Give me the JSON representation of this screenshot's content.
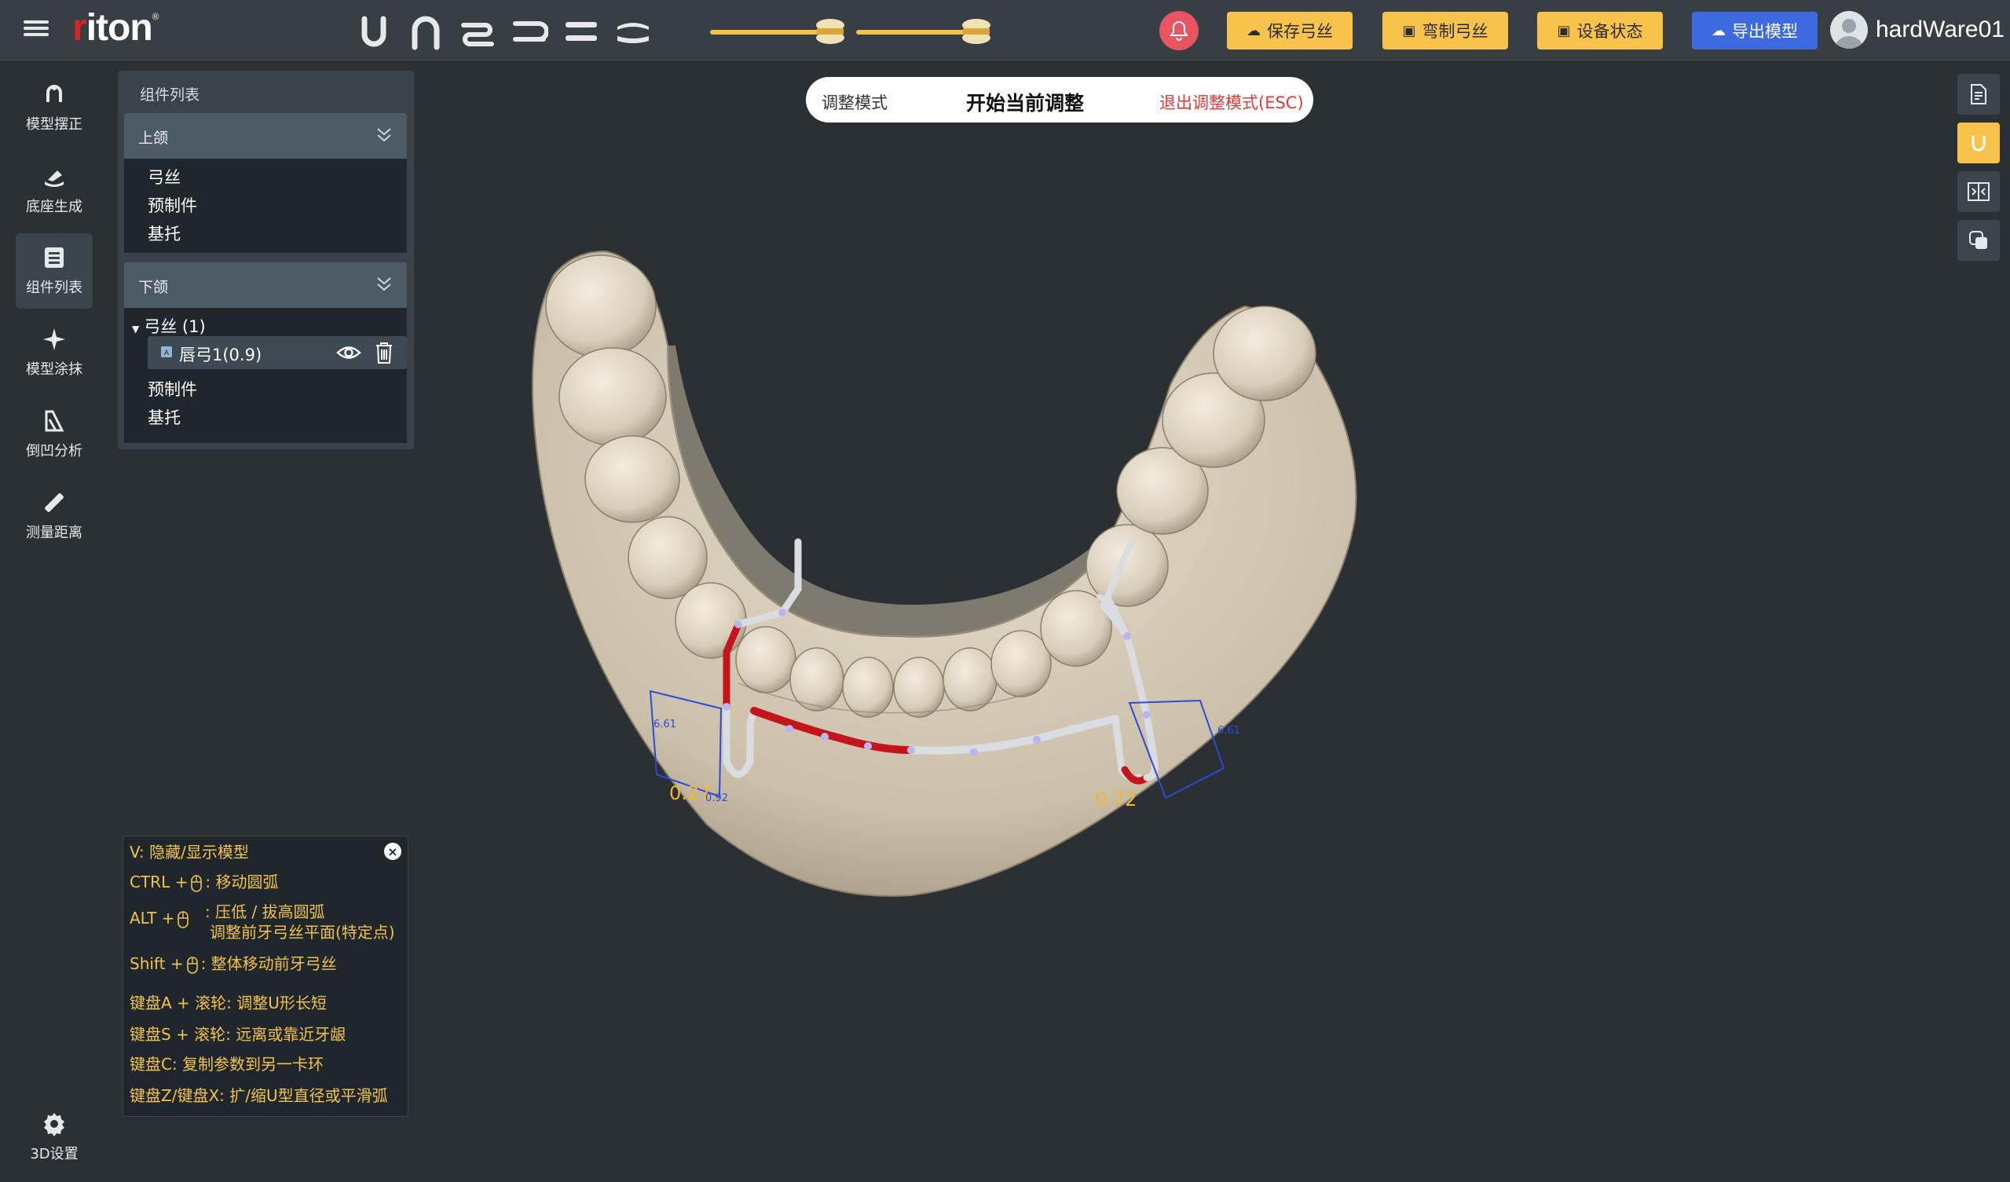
{
  "app": {
    "logo_text": "riton",
    "logo_mark": "®"
  },
  "topbar": {
    "buttons": {
      "save": "保存弓丝",
      "bend": "弯制弓丝",
      "device": "设备状态",
      "export": "导出模型"
    },
    "username": "hardWare01",
    "colors": {
      "accent_yellow": "#f8c34b",
      "accent_blue": "#3d6ae0",
      "bell": "#e8545f"
    }
  },
  "sidebar": {
    "items": [
      {
        "label": "模型摆正",
        "icon": "model-align-icon"
      },
      {
        "label": "底座生成",
        "icon": "base-generate-icon"
      },
      {
        "label": "组件列表",
        "icon": "component-list-icon"
      },
      {
        "label": "模型涂抹",
        "icon": "model-paint-icon"
      },
      {
        "label": "倒凹分析",
        "icon": "undercut-analysis-icon"
      },
      {
        "label": "测量距离",
        "icon": "measure-distance-icon"
      }
    ],
    "settings_label": "3D设置"
  },
  "component_panel": {
    "title": "组件列表",
    "upper": {
      "header": "上颌",
      "items": [
        "弓丝",
        "预制件",
        "基托"
      ]
    },
    "lower": {
      "header": "下颌",
      "wire_group": "弓丝 (1)",
      "wire_item": "唇弓1(0.9)",
      "items": [
        "预制件",
        "基托"
      ]
    }
  },
  "adjust_bar": {
    "mode_label": "调整模式",
    "start_label": "开始当前调整",
    "exit_label": "退出调整模式(ESC)"
  },
  "viewport": {
    "left_value": "0.27",
    "right_value": "0.72",
    "left_dim": "6.61",
    "right_dim": "6.61",
    "left_small": "0.92"
  },
  "help": {
    "lines": [
      "V: 隐藏/显示模型",
      "CTRL +",
      ": 移动圆弧",
      "ALT +",
      ": 压低 / 拔高圆弧",
      "调整前牙弓丝平面(特定点)",
      "Shift +",
      ": 整体移动前牙弓丝",
      "键盘A + 滚轮: 调整U形长短",
      "键盘S + 滚轮: 远离或靠近牙龈",
      "键盘C: 复制参数到另一卡环",
      "键盘Z/键盘X: 扩/缩U型直径或平滑弧"
    ]
  }
}
